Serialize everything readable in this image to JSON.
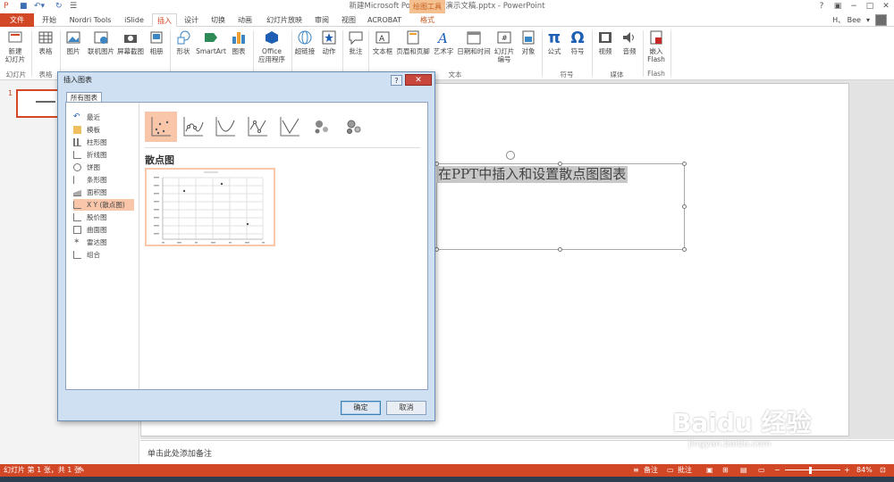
{
  "window": {
    "doc_title": "新建Microsoft PowerPoint 演示文稿.pptx - PowerPoint",
    "tool_tab_top": "绘图工具",
    "help": "?"
  },
  "tabs": {
    "file": "文件",
    "items": [
      "开始",
      "Nordri Tools",
      "iSlide",
      "插入",
      "设计",
      "切换",
      "动画",
      "幻灯片放映",
      "审阅",
      "视图",
      "ACROBAT",
      "格式"
    ],
    "user": "H、 Bee"
  },
  "ribbon": {
    "new_slide": "新建\n幻灯片",
    "table": "表格",
    "picture": "图片",
    "online_picture": "联机图片",
    "screenshot": "屏幕截图",
    "album": "相册",
    "shapes": "形状",
    "smartart": "SmartArt",
    "chart": "图表",
    "office_apps": "Office\n应用程序",
    "hyperlink": "超链接",
    "action": "动作",
    "comment": "批注",
    "textbox": "文本框",
    "header_footer": "页眉和页脚",
    "wordart": "艺术字",
    "datetime": "日期和时间",
    "slide_number": "幻灯片\n编号",
    "object": "对象",
    "equation": "公式",
    "symbol": "符号",
    "video": "视频",
    "audio": "音频",
    "flash": "嵌入\nFlash",
    "groups": {
      "slides": "幻灯片",
      "tables": "表格",
      "text": "文本",
      "symbols": "符号",
      "media": "媒体",
      "flash": "Flash"
    }
  },
  "thumbnails": {
    "slide_number": "1"
  },
  "slide": {
    "text": "在PPT中插入和设置散点图图表"
  },
  "notes": {
    "placeholder": "单击此处添加备注"
  },
  "statusbar": {
    "left": "幻灯片 第 1 张，共 1 张",
    "notes": "备注",
    "comments": "批注",
    "zoom": "84%"
  },
  "dialog": {
    "title": "插入图表",
    "tab": "所有图表",
    "categories": [
      "最近",
      "模板",
      "柱形图",
      "折线图",
      "饼图",
      "条形图",
      "面积图",
      "X Y (散点图)",
      "股价图",
      "曲面图",
      "雷达图",
      "组合"
    ],
    "selected_category_index": 7,
    "subtype_title": "散点图",
    "ok": "确定",
    "cancel": "取消"
  },
  "watermark": {
    "brand": "Baidu 经验",
    "url": "jingyan.baidu.com"
  },
  "colors": {
    "accent": "#d24726",
    "selection": "#f9c6aa"
  }
}
